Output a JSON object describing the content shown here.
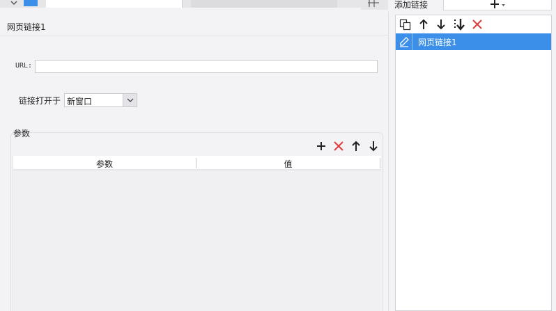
{
  "panel": {
    "title": "网页链接1"
  },
  "form": {
    "url_label": "URL:",
    "url_value": "",
    "open_in_label": "链接打开于",
    "open_in_value": "新窗口"
  },
  "params": {
    "group_label": "参数",
    "columns": [
      "参数",
      "值"
    ],
    "rows": []
  },
  "links": {
    "header_label": "添加链接",
    "items": [
      {
        "label": "网页链接1",
        "selected": true
      }
    ]
  },
  "colors": {
    "selection": "#3b8fe8",
    "delete": "#e03a3a",
    "background": "#f3f3f5"
  }
}
